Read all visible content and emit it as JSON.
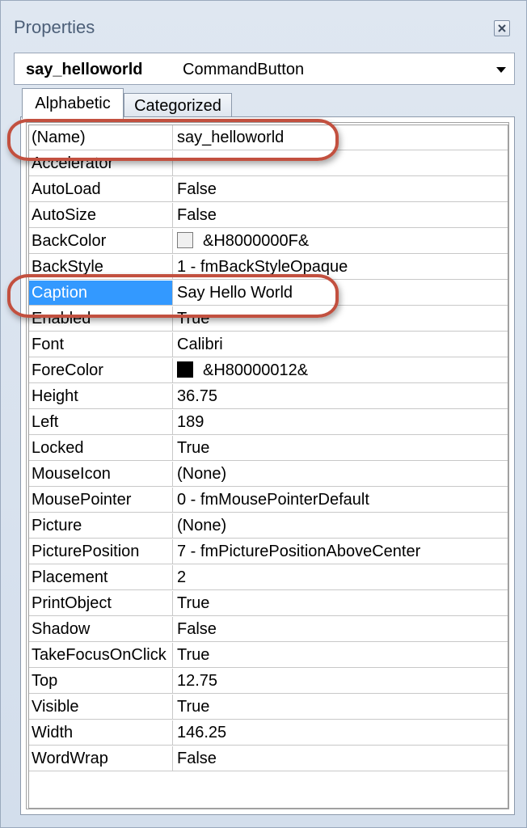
{
  "window": {
    "title": "Properties"
  },
  "object_selector": {
    "name": "say_helloworld",
    "type": "CommandButton"
  },
  "tabs": [
    {
      "label": "Alphabetic",
      "active": true
    },
    {
      "label": "Categorized",
      "active": false
    }
  ],
  "properties": [
    {
      "name": "(Name)",
      "value": "say_helloworld"
    },
    {
      "name": "Accelerator",
      "value": ""
    },
    {
      "name": "AutoLoad",
      "value": "False"
    },
    {
      "name": "AutoSize",
      "value": "False"
    },
    {
      "name": "BackColor",
      "value": "&H8000000F&",
      "swatch": "#f0f0f0"
    },
    {
      "name": "BackStyle",
      "value": "1 - fmBackStyleOpaque"
    },
    {
      "name": "Caption",
      "value": "Say Hello World",
      "selected": true
    },
    {
      "name": "Enabled",
      "value": "True"
    },
    {
      "name": "Font",
      "value": "Calibri"
    },
    {
      "name": "ForeColor",
      "value": "&H80000012&",
      "swatch": "#000000"
    },
    {
      "name": "Height",
      "value": "36.75"
    },
    {
      "name": "Left",
      "value": "189"
    },
    {
      "name": "Locked",
      "value": "True"
    },
    {
      "name": "MouseIcon",
      "value": "(None)"
    },
    {
      "name": "MousePointer",
      "value": "0 - fmMousePointerDefault"
    },
    {
      "name": "Picture",
      "value": "(None)"
    },
    {
      "name": "PicturePosition",
      "value": "7 - fmPicturePositionAboveCenter"
    },
    {
      "name": "Placement",
      "value": "2"
    },
    {
      "name": "PrintObject",
      "value": "True"
    },
    {
      "name": "Shadow",
      "value": "False"
    },
    {
      "name": "TakeFocusOnClick",
      "value": "True"
    },
    {
      "name": "Top",
      "value": "12.75"
    },
    {
      "name": "Visible",
      "value": "True"
    },
    {
      "name": "Width",
      "value": "146.25"
    },
    {
      "name": "WordWrap",
      "value": "False"
    }
  ],
  "colors": {
    "selection": "#3399ff",
    "highlight_ring": "#c2503f"
  },
  "icons": {
    "close": "close-icon",
    "dropdown": "chevron-down-icon"
  }
}
